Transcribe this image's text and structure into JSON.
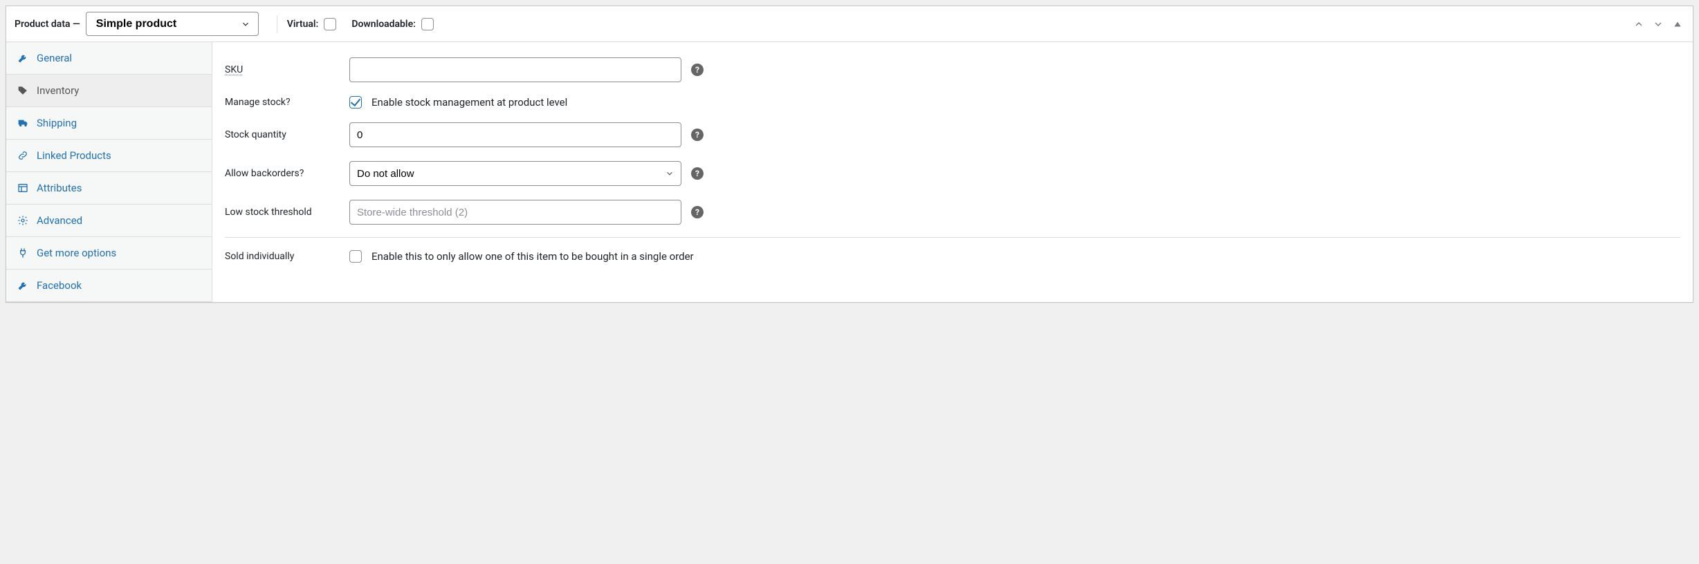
{
  "header": {
    "title": "Product data —",
    "product_type": "Simple product",
    "virtual_label": "Virtual:",
    "virtual_checked": false,
    "downloadable_label": "Downloadable:",
    "downloadable_checked": false
  },
  "tabs": [
    {
      "key": "general",
      "label": "General",
      "icon": "wrench",
      "active": false
    },
    {
      "key": "inventory",
      "label": "Inventory",
      "icon": "tag",
      "active": true
    },
    {
      "key": "shipping",
      "label": "Shipping",
      "icon": "truck",
      "active": false
    },
    {
      "key": "linked",
      "label": "Linked Products",
      "icon": "link",
      "active": false
    },
    {
      "key": "attributes",
      "label": "Attributes",
      "icon": "layout",
      "active": false
    },
    {
      "key": "advanced",
      "label": "Advanced",
      "icon": "gear",
      "active": false
    },
    {
      "key": "getmore",
      "label": "Get more options",
      "icon": "plug",
      "active": false
    },
    {
      "key": "facebook",
      "label": "Facebook",
      "icon": "wrench",
      "active": false
    }
  ],
  "inventory": {
    "sku_label": "SKU",
    "sku_value": "",
    "manage_stock_label": "Manage stock?",
    "manage_stock_text": "Enable stock management at product level",
    "manage_stock_checked": true,
    "stock_qty_label": "Stock quantity",
    "stock_qty_value": "0",
    "backorders_label": "Allow backorders?",
    "backorders_value": "Do not allow",
    "low_stock_label": "Low stock threshold",
    "low_stock_placeholder": "Store-wide threshold (2)",
    "low_stock_value": "",
    "sold_individually_label": "Sold individually",
    "sold_individually_text": "Enable this to only allow one of this item to be bought in a single order",
    "sold_individually_checked": false
  },
  "help_tooltip": "?"
}
